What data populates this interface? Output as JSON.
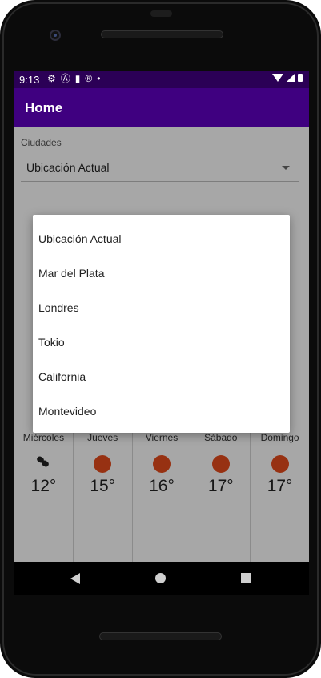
{
  "status_bar": {
    "time": "9:13"
  },
  "app_bar": {
    "title": "Home"
  },
  "city_selector": {
    "label": "Ciudades",
    "selected": "Ubicación Actual"
  },
  "city_menu": {
    "options": [
      "Ubicación Actual",
      "Mar del Plata",
      "Londres",
      "Tokio",
      "California",
      "Montevideo"
    ]
  },
  "forecast": {
    "days": [
      {
        "name": "Miércoles",
        "temp": "12°",
        "icon": "rain-icon"
      },
      {
        "name": "Jueves",
        "temp": "15°",
        "icon": "sun-icon"
      },
      {
        "name": "Viernes",
        "temp": "16°",
        "icon": "sun-icon"
      },
      {
        "name": "Sábado",
        "temp": "17°",
        "icon": "sun-icon"
      },
      {
        "name": "Domingo",
        "temp": "17°",
        "icon": "sun-icon"
      }
    ]
  },
  "colors": {
    "status_bar": "#2b0056",
    "app_bar": "#3f0080",
    "sun": "#e24a1b"
  }
}
